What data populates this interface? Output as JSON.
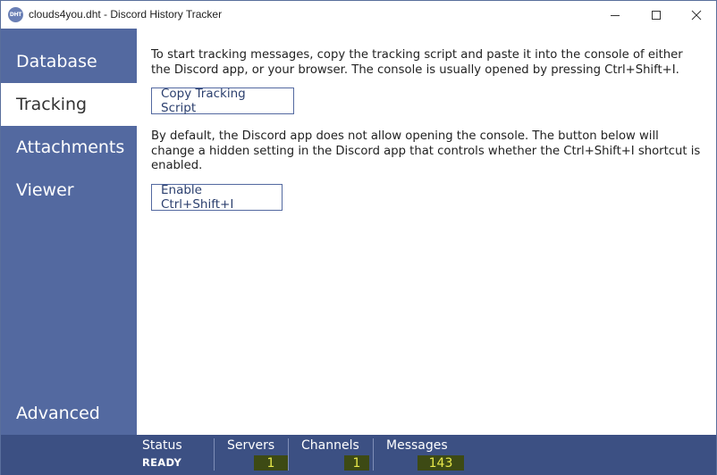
{
  "window": {
    "title": "clouds4you.dht - Discord History Tracker",
    "icon_text": "DHT",
    "controls": {
      "minimize": "minimize-icon",
      "maximize": "maximize-icon",
      "close": "close-icon"
    }
  },
  "sidebar": {
    "items": [
      {
        "label": "Database",
        "active": false
      },
      {
        "label": "Tracking",
        "active": true
      },
      {
        "label": "Attachments",
        "active": false
      },
      {
        "label": "Viewer",
        "active": false
      },
      {
        "label": "Advanced",
        "active": false
      }
    ]
  },
  "tracking": {
    "intro_text": "To start tracking messages, copy the tracking script and paste it into the console of either the Discord app, or your browser. The console is usually opened by pressing Ctrl+Shift+I.",
    "copy_button": "Copy Tracking Script",
    "shortcut_text": "By default, the Discord app does not allow opening the console. The button below will change a hidden setting in the Discord app that controls whether the Ctrl+Shift+I shortcut is enabled.",
    "enable_button": "Enable Ctrl+Shift+I"
  },
  "statusbar": {
    "status_label": "Status",
    "status_value": "READY",
    "servers_label": "Servers",
    "servers_value": "1",
    "channels_label": "Channels",
    "channels_value": "1",
    "messages_label": "Messages",
    "messages_value": "143"
  },
  "colors": {
    "sidebar": "#5369a0",
    "statusbar": "#3c5083",
    "highlight_bg": "#3d4a14",
    "highlight_text": "#e9e94a"
  }
}
